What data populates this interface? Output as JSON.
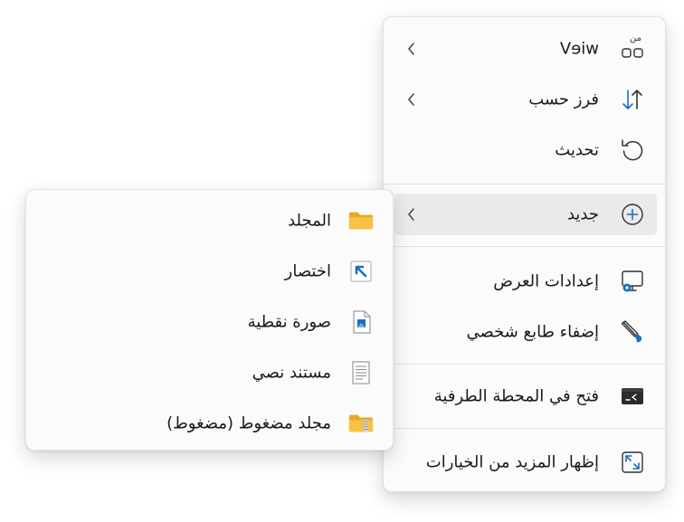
{
  "main_menu": {
    "items": [
      {
        "label": "Vɘiw",
        "icon": "grid-view-icon",
        "has_submenu": true
      },
      {
        "label": "فرز حسب",
        "icon": "sort-arrows-icon",
        "has_submenu": true
      },
      {
        "label": "تحديث",
        "icon": "refresh-icon",
        "has_submenu": false
      },
      {
        "label": "جديد",
        "icon": "new-plus-circle-icon",
        "has_submenu": true,
        "highlighted": true
      },
      {
        "label": "إعدادات العرض",
        "icon": "display-settings-icon",
        "has_submenu": false
      },
      {
        "label": "إضفاء طابع شخصي",
        "icon": "personalize-brush-icon",
        "has_submenu": false
      },
      {
        "label": "فتح في المحطة الطرفية",
        "icon": "terminal-icon",
        "has_submenu": false
      },
      {
        "label": "إظهار المزيد من الخيارات",
        "icon": "expand-options-icon",
        "has_submenu": false
      }
    ],
    "view_icon_overlay_text": "من"
  },
  "new_submenu": {
    "items": [
      {
        "label": "المجلد",
        "icon": "folder-icon"
      },
      {
        "label": "اختصار",
        "icon": "shortcut-icon"
      },
      {
        "label": "صورة نقطية",
        "icon": "bitmap-image-icon"
      },
      {
        "label": "مستند نصي",
        "icon": "text-document-icon"
      },
      {
        "label": "مجلد مضغوط (مضغوط)",
        "icon": "zip-folder-icon"
      }
    ]
  },
  "colors": {
    "accent_blue": "#1a6fc4",
    "folder_yellow": "#f6c343",
    "menu_bg": "#fbfbfb",
    "highlight_bg": "#eaeaea"
  }
}
